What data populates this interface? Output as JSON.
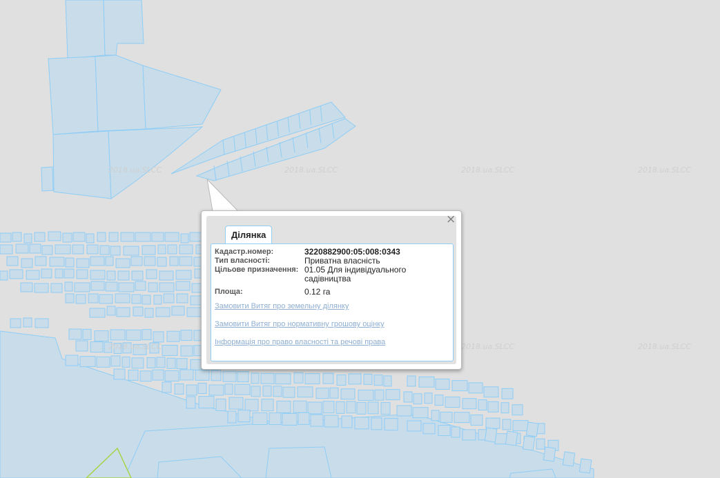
{
  "map": {
    "watermark": "2018.ua.SLCC",
    "colors": {
      "background": "#e0e0e0",
      "parcel_fill": "#c8dcea",
      "parcel_border": "#8fcdf5",
      "highlight_border": "#a6d54a"
    }
  },
  "popup": {
    "tab_label": "Ділянка",
    "close_symbol": "×",
    "fields": [
      {
        "label": "Кадастр.номер:",
        "value": "3220882900:05:008:0343"
      },
      {
        "label": "Тип власності:",
        "value": "Приватна власність"
      },
      {
        "label": "Цільове призначення:",
        "value": "01.05 Для індивідуального садівництва"
      },
      {
        "label": "Площа:",
        "value": "0.12 га"
      }
    ],
    "links": [
      "Замовити Витяг про земельну ділянку",
      "Замовити Витяг про нормативну грошову оцінку",
      "Інформація про право власності та речові права"
    ]
  }
}
